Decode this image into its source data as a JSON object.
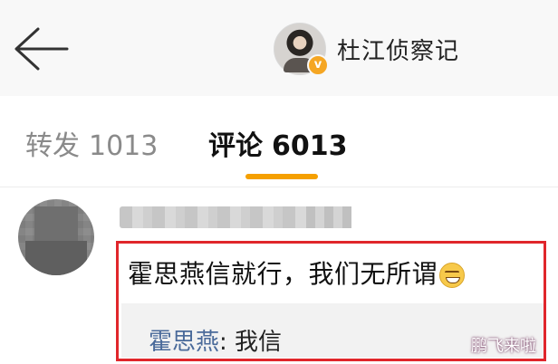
{
  "header": {
    "account_name": "杜江侦察记",
    "verified_badge": "v"
  },
  "tabs": [
    {
      "label": "转发",
      "count": "1013",
      "active": false
    },
    {
      "label": "评论",
      "count": "6013",
      "active": true
    }
  ],
  "comment": {
    "text": "霍思燕信就行，我们无所谓",
    "emoji": "grin-emoji",
    "reply": {
      "author": "霍思燕",
      "separator": ": ",
      "text": "我信"
    }
  },
  "watermark": "鹏飞来啦",
  "colors": {
    "accent": "#f5a000",
    "highlight_border": "#e0262b",
    "link": "#4a6a9a"
  }
}
